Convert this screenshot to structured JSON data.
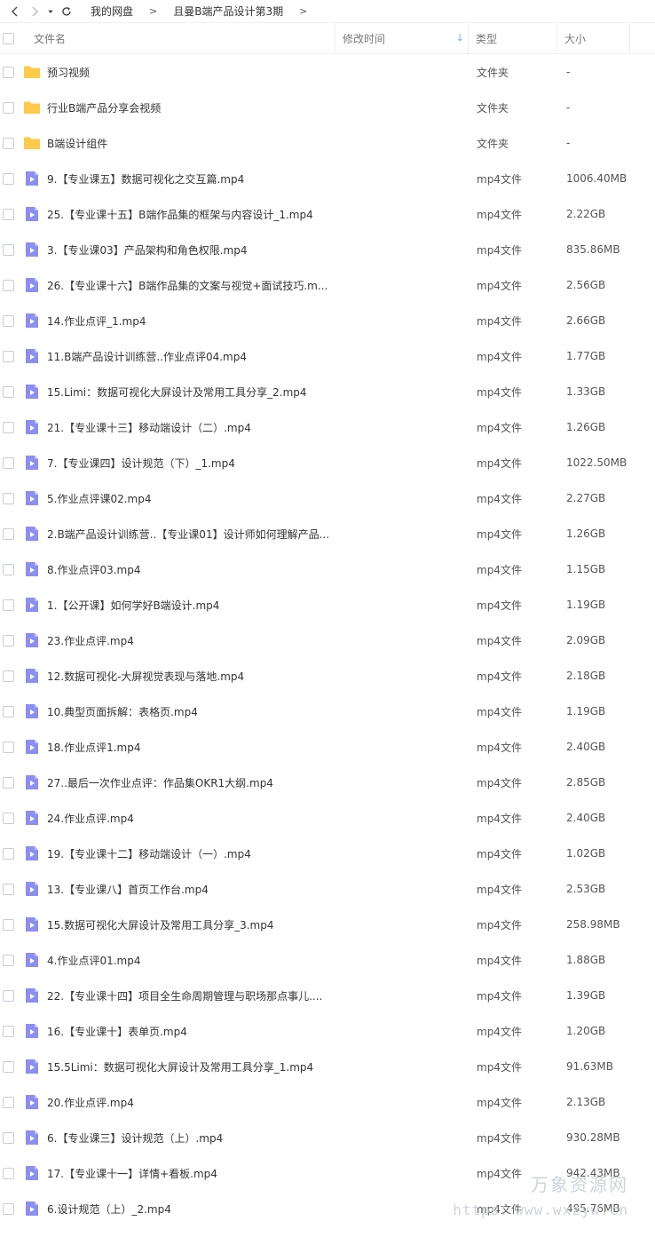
{
  "toolbar": {
    "back_icon": "chevron-left-icon",
    "forward_icon": "chevron-right-icon",
    "dropdown_icon": "caret-down-icon",
    "refresh_icon": "refresh-icon",
    "breadcrumb": [
      "我的网盘",
      "且曼B端产品设计第3期"
    ],
    "separator": ">"
  },
  "header": {
    "name": "文件名",
    "mtime": "修改时间",
    "type": "类型",
    "size": "大小",
    "sort_icon": "arrow-down-icon"
  },
  "colors": {
    "folder": "#ffc94a",
    "video": "#8c8ef2",
    "accent": "#2b8ff0"
  },
  "rows": [
    {
      "name": "预习视频",
      "type": "文件夹",
      "size": "-",
      "icon": "folder"
    },
    {
      "name": "行业B端产品分享会视频",
      "type": "文件夹",
      "size": "-",
      "icon": "folder"
    },
    {
      "name": "B端设计组件",
      "type": "文件夹",
      "size": "-",
      "icon": "folder"
    },
    {
      "name": "9.【专业课五】数据可视化之交互篇.mp4",
      "type": "mp4文件",
      "size": "1006.40MB",
      "icon": "video"
    },
    {
      "name": "25.【专业课十五】B端作品集的框架与内容设计_1.mp4",
      "type": "mp4文件",
      "size": "2.22GB",
      "icon": "video"
    },
    {
      "name": "3.【专业课03】产品架构和角色权限.mp4",
      "type": "mp4文件",
      "size": "835.86MB",
      "icon": "video"
    },
    {
      "name": "26.【专业课十六】B端作品集的文案与视觉+面试技巧.m...",
      "type": "mp4文件",
      "size": "2.56GB",
      "icon": "video"
    },
    {
      "name": "14.作业点评_1.mp4",
      "type": "mp4文件",
      "size": "2.66GB",
      "icon": "video"
    },
    {
      "name": "11.B端产品设计训练营..作业点评04.mp4",
      "type": "mp4文件",
      "size": "1.77GB",
      "icon": "video"
    },
    {
      "name": "15.Limi：数据可视化大屏设计及常用工具分享_2.mp4",
      "type": "mp4文件",
      "size": "1.33GB",
      "icon": "video"
    },
    {
      "name": "21.【专业课十三】移动端设计（二）.mp4",
      "type": "mp4文件",
      "size": "1.26GB",
      "icon": "video"
    },
    {
      "name": "7.【专业课四】设计规范（下）_1.mp4",
      "type": "mp4文件",
      "size": "1022.50MB",
      "icon": "video"
    },
    {
      "name": "5.作业点评课02.mp4",
      "type": "mp4文件",
      "size": "2.27GB",
      "icon": "video"
    },
    {
      "name": "2.B端产品设计训练营..【专业课01】设计师如何理解产品...",
      "type": "mp4文件",
      "size": "1.26GB",
      "icon": "video"
    },
    {
      "name": "8.作业点评03.mp4",
      "type": "mp4文件",
      "size": "1.15GB",
      "icon": "video"
    },
    {
      "name": "1.【公开课】如何学好B端设计.mp4",
      "type": "mp4文件",
      "size": "1.19GB",
      "icon": "video"
    },
    {
      "name": "23.作业点评.mp4",
      "type": "mp4文件",
      "size": "2.09GB",
      "icon": "video"
    },
    {
      "name": "12.数据可视化-大屏视觉表现与落地.mp4",
      "type": "mp4文件",
      "size": "2.18GB",
      "icon": "video"
    },
    {
      "name": "10.典型页面拆解：表格页.mp4",
      "type": "mp4文件",
      "size": "1.19GB",
      "icon": "video"
    },
    {
      "name": "18.作业点评1.mp4",
      "type": "mp4文件",
      "size": "2.40GB",
      "icon": "video"
    },
    {
      "name": "27..最后一次作业点评：作品集OKR1大纲.mp4",
      "type": "mp4文件",
      "size": "2.85GB",
      "icon": "video"
    },
    {
      "name": "24.作业点评.mp4",
      "type": "mp4文件",
      "size": "2.40GB",
      "icon": "video"
    },
    {
      "name": "19.【专业课十二】移动端设计（一）.mp4",
      "type": "mp4文件",
      "size": "1.02GB",
      "icon": "video"
    },
    {
      "name": "13.【专业课八】首页工作台.mp4",
      "type": "mp4文件",
      "size": "2.53GB",
      "icon": "video"
    },
    {
      "name": "15.数据可视化大屏设计及常用工具分享_3.mp4",
      "type": "mp4文件",
      "size": "258.98MB",
      "icon": "video"
    },
    {
      "name": "4.作业点评01.mp4",
      "type": "mp4文件",
      "size": "1.88GB",
      "icon": "video"
    },
    {
      "name": "22.【专业课十四】项目全生命周期管理与职场那点事儿....",
      "type": "mp4文件",
      "size": "1.39GB",
      "icon": "video"
    },
    {
      "name": "16.【专业课十】表单页.mp4",
      "type": "mp4文件",
      "size": "1.20GB",
      "icon": "video"
    },
    {
      "name": "15.5Limi：数据可视化大屏设计及常用工具分享_1.mp4",
      "type": "mp4文件",
      "size": "91.63MB",
      "icon": "video"
    },
    {
      "name": "20.作业点评.mp4",
      "type": "mp4文件",
      "size": "2.13GB",
      "icon": "video"
    },
    {
      "name": "6.【专业课三】设计规范（上）.mp4",
      "type": "mp4文件",
      "size": "930.28MB",
      "icon": "video"
    },
    {
      "name": "17.【专业课十一】详情+看板.mp4",
      "type": "mp4文件",
      "size": "942.43MB",
      "icon": "video"
    },
    {
      "name": "6.设计规范（上）_2.mp4",
      "type": "mp4文件",
      "size": "495.76MB",
      "icon": "video"
    }
  ],
  "watermark": {
    "line1": "万象资源网",
    "line2": "https：www.wxzyw.cn"
  }
}
